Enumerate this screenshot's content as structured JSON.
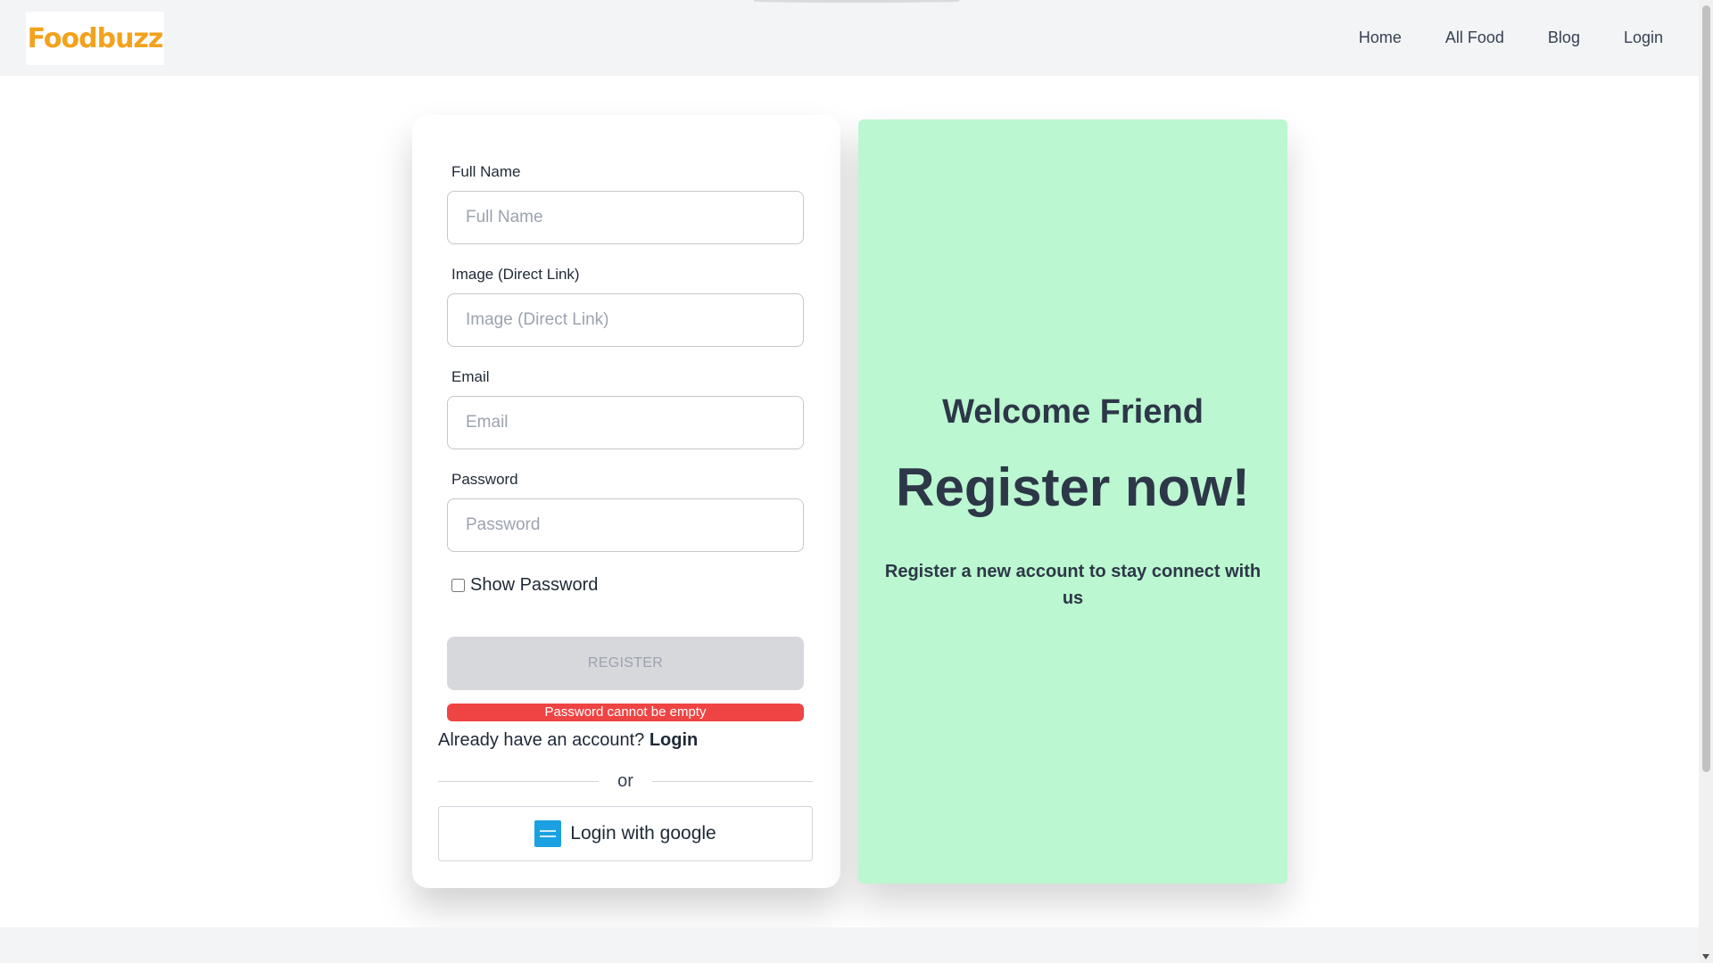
{
  "nav": {
    "logo_text": "Foodbuzz",
    "links": [
      "Home",
      "All Food",
      "Blog",
      "Login"
    ]
  },
  "form": {
    "full_name_label": "Full Name",
    "full_name_placeholder": "Full Name",
    "image_label": "Image (Direct Link)",
    "image_placeholder": "Image (Direct Link)",
    "email_label": "Email",
    "email_placeholder": "Email",
    "password_label": "Password",
    "password_placeholder": "Password",
    "show_password_label": "Show Password",
    "register_label": "REGISTER",
    "error_message": "Password cannot be empty",
    "already_text": "Already have an account?",
    "login_link": "Login",
    "or_text": "or",
    "google_label": "Login with google"
  },
  "welcome": {
    "title": "Welcome Friend",
    "headline": "Register now!",
    "subtitle": "Register a new account to stay connect with us"
  },
  "colors": {
    "accent_green": "#bbf7d0",
    "error_red": "#ef4444",
    "logo_orange": "#f2a21d"
  }
}
